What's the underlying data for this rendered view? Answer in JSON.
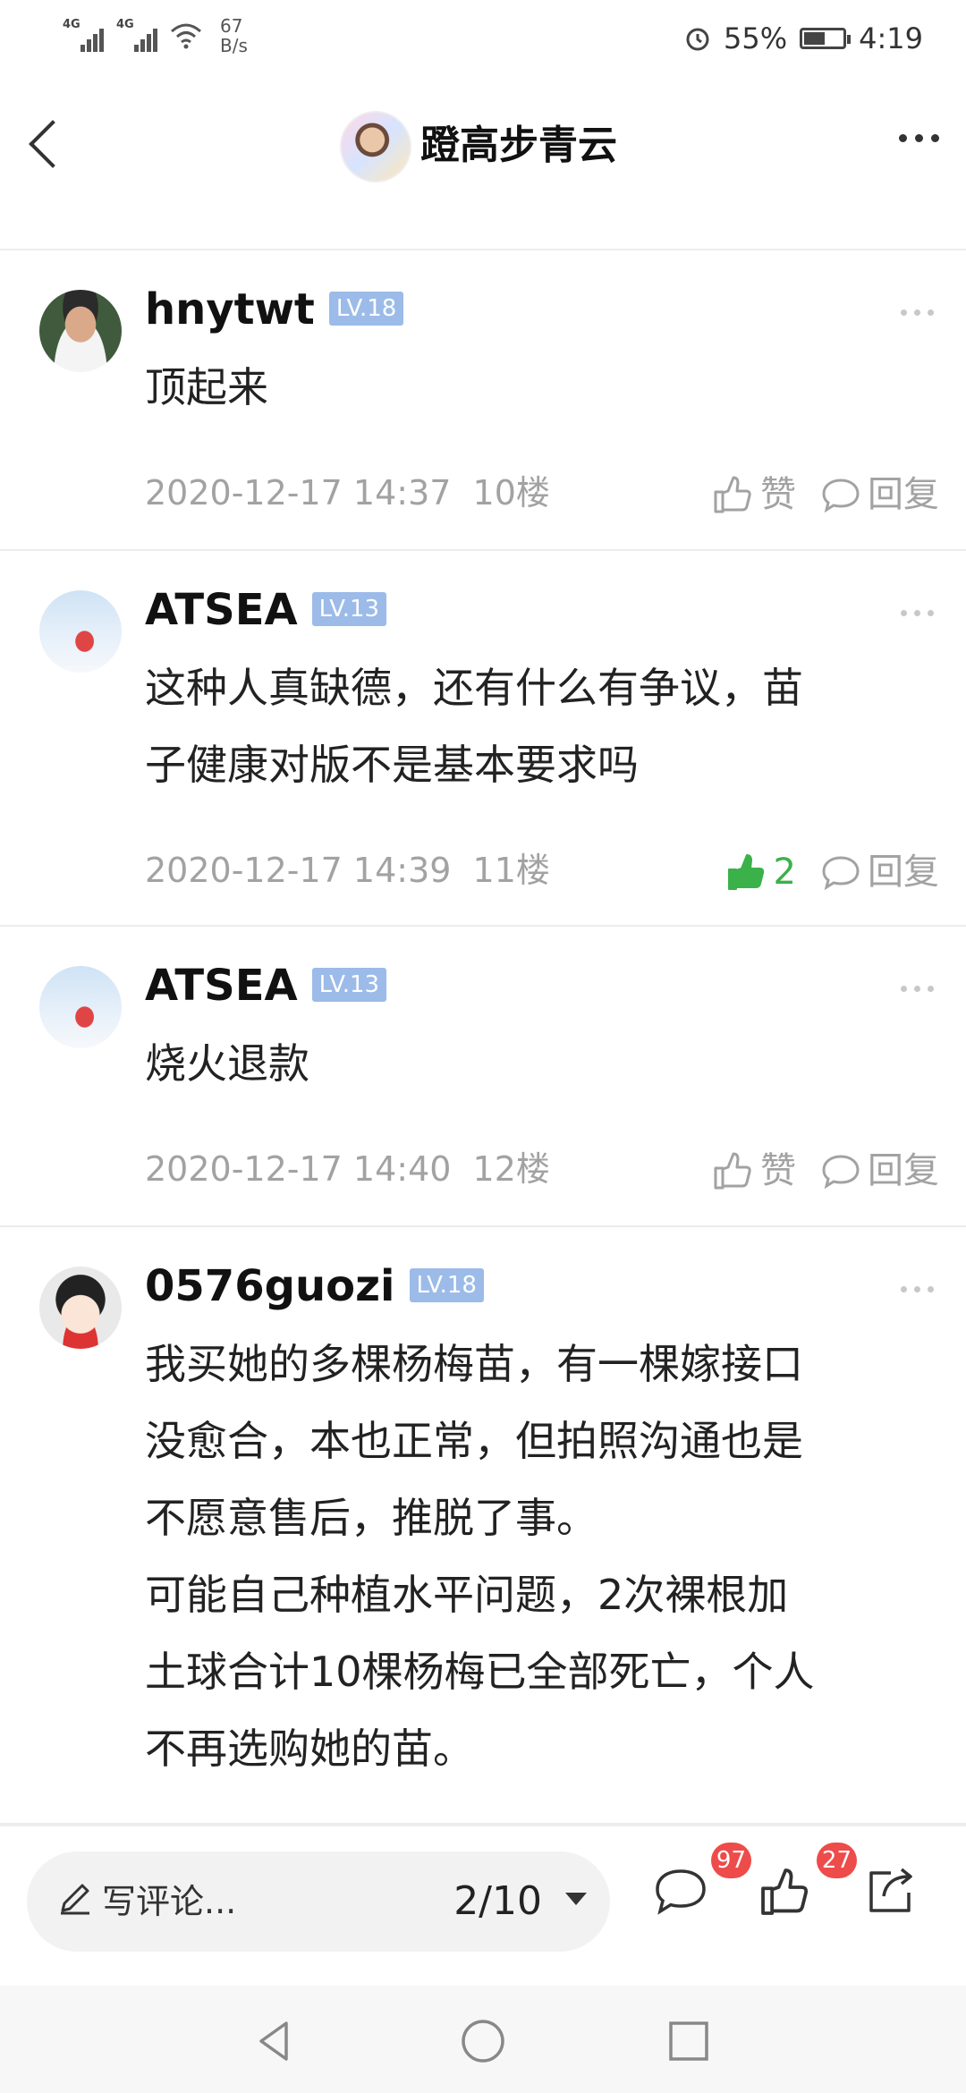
{
  "status_bar": {
    "signal1": "4G",
    "signal2": "4G",
    "net_speed_value": "67",
    "net_speed_unit": "B/s",
    "battery_percent": "55%",
    "battery_level": 0.55,
    "time": "4:19",
    "icons": [
      "signal-icon",
      "wifi-icon",
      "alarm-icon",
      "battery-icon"
    ]
  },
  "header": {
    "title": "蹬高步青云",
    "back_icon": "chevron-left-icon",
    "more_icon": "more-horizontal-icon"
  },
  "comments": [
    {
      "user": "hnytwt",
      "level": "LV.18",
      "text": "顶起来",
      "date": "2020-12-17 14:37",
      "floor": "10楼",
      "like_label": "赞",
      "liked": false,
      "reply_label": "回复"
    },
    {
      "user": "ATSEA",
      "level": "LV.13",
      "text": "这种人真缺德，还有什么有争议，苗\n子健康对版不是基本要求吗",
      "date": "2020-12-17 14:39",
      "floor": "11楼",
      "like_label": "2",
      "liked": true,
      "reply_label": "回复"
    },
    {
      "user": "ATSEA",
      "level": "LV.13",
      "text": "烧火退款",
      "date": "2020-12-17 14:40",
      "floor": "12楼",
      "like_label": "赞",
      "liked": false,
      "reply_label": "回复"
    },
    {
      "user": "0576guozi",
      "level": "LV.18",
      "text": "我买她的多棵杨梅苗，有一棵嫁接口\n没愈合，本也正常，但拍照沟通也是\n不愿意售后，推脱了事。\n可能自己种植水平问题，2次裸根加\n土球合计10棵杨梅已全部死亡，个人\n不再选购她的苗。"
    }
  ],
  "bottom_bar": {
    "write_placeholder": "写评论...",
    "page_indicator": "2/10",
    "comment_count": "97",
    "like_count": "27",
    "icons": [
      "pen-icon",
      "comment-icon",
      "thumb-up-icon",
      "share-icon"
    ]
  },
  "nav_bar": {
    "icons": [
      "nav-back-icon",
      "nav-home-icon",
      "nav-recents-icon"
    ]
  }
}
